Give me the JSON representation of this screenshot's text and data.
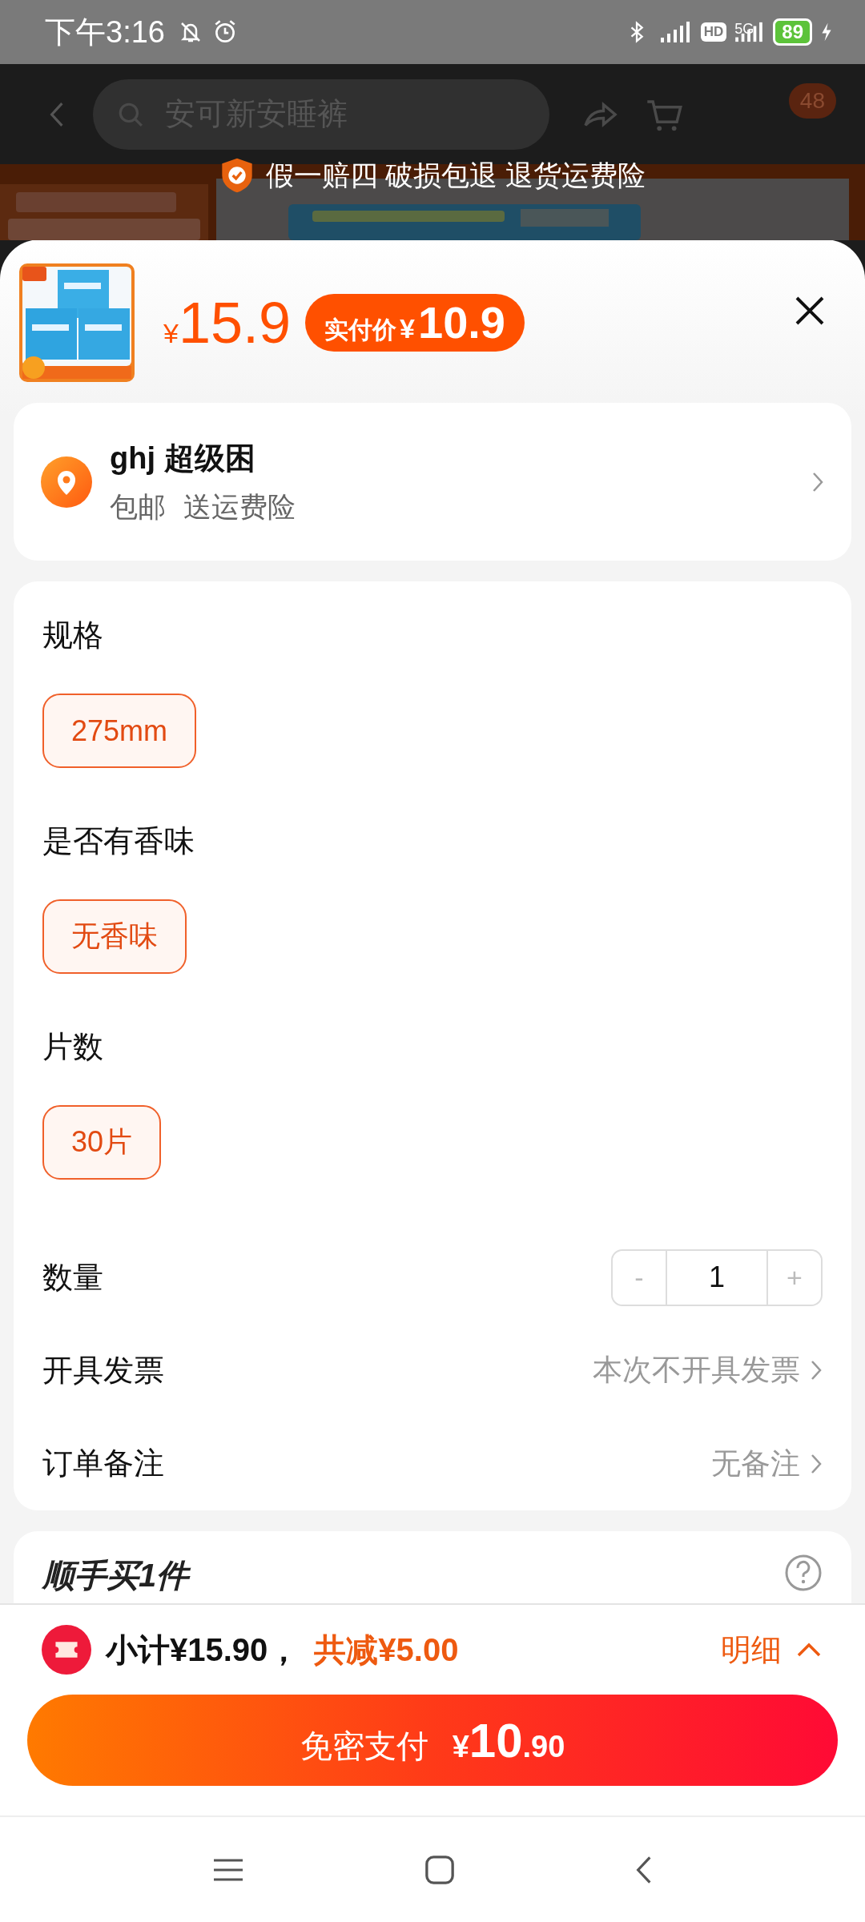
{
  "status_bar": {
    "time": "下午3:16",
    "network": "5G",
    "hd": "HD",
    "battery": "89"
  },
  "header": {
    "search": {
      "placeholder": "安可新安睡裤"
    },
    "cart_badge": "48"
  },
  "guarantee": "假一赔四 破损包退 退货运费险",
  "product": {
    "currency": "¥",
    "price": "15.9",
    "final_badge": {
      "label": "实付价",
      "currency": "¥",
      "price": "10.9"
    }
  },
  "address": {
    "name": "ghj 超级困",
    "tags": [
      "包邮",
      "送运费险"
    ]
  },
  "spec_groups": [
    {
      "title": "规格",
      "options": [
        {
          "label": "275mm",
          "selected": true
        }
      ]
    },
    {
      "title": "是否有香味",
      "options": [
        {
          "label": "无香味",
          "selected": true
        }
      ]
    },
    {
      "title": "片数",
      "options": [
        {
          "label": "30片",
          "selected": true
        }
      ]
    }
  ],
  "quantity": {
    "label": "数量",
    "minus": "-",
    "value": "1",
    "plus": "+"
  },
  "option_rows": [
    {
      "label": "开具发票",
      "value": "本次不开具发票"
    },
    {
      "label": "订单备注",
      "value": "无备注"
    }
  ],
  "addon": {
    "title": "顺手买1件"
  },
  "summary": {
    "subtotal": "小计¥15.90，",
    "discount": "共减¥5.00",
    "details": "明细"
  },
  "pay_button": {
    "label": "免密支付",
    "currency": "¥",
    "integer": "10",
    "decimal": ".90"
  }
}
